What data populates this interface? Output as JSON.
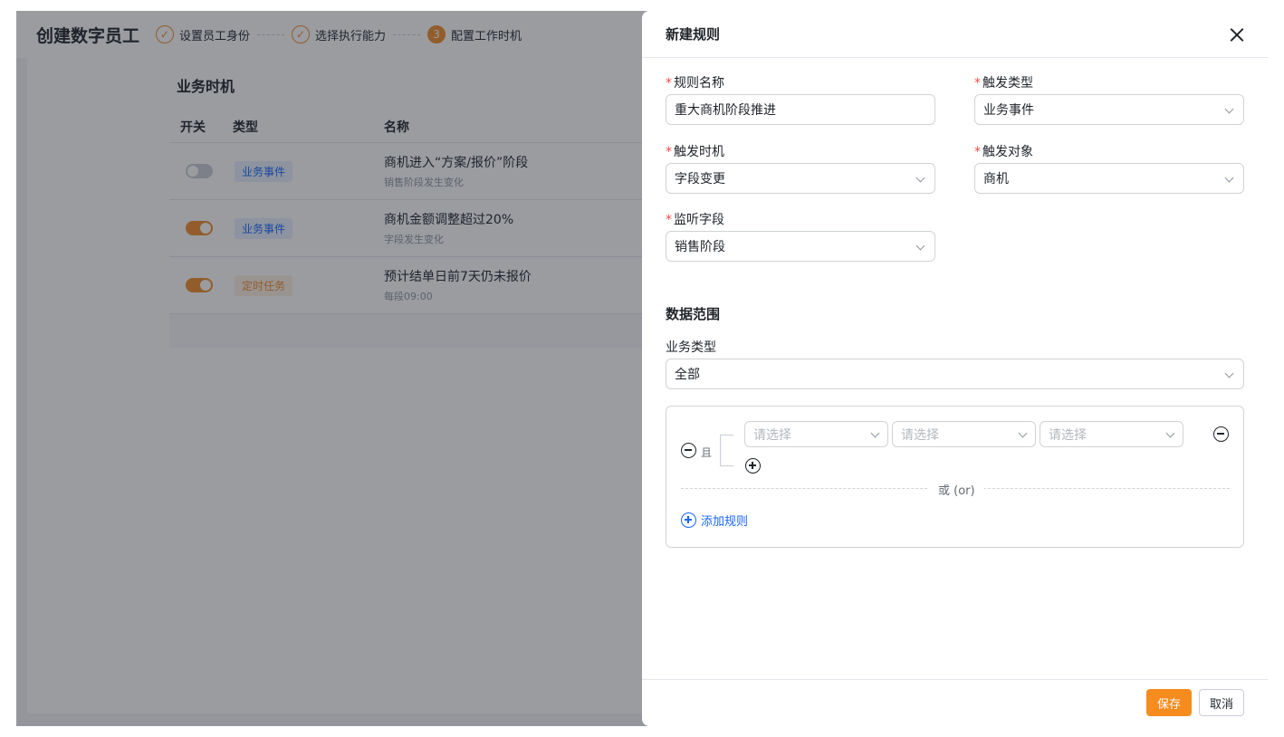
{
  "app": {
    "title": "创建数字员工",
    "steps": [
      {
        "num": "",
        "label": "设置员工身份"
      },
      {
        "num": "",
        "label": "选择执行能力"
      },
      {
        "num": "3",
        "label": "配置工作时机"
      }
    ]
  },
  "page": {
    "section_title": "业务时机",
    "columns": [
      "开关",
      "类型",
      "名称"
    ],
    "rows": [
      {
        "enabled": false,
        "type": "业务事件",
        "name": "商机进入“方案/报价”阶段",
        "desc": "销售阶段发生变化"
      },
      {
        "enabled": true,
        "type": "业务事件",
        "name": "商机金额调整超过20%",
        "desc": "字段发生变化"
      },
      {
        "enabled": true,
        "type": "定时任务",
        "name": "预计结单日前7天仍未报价",
        "desc": "每段09:00"
      }
    ]
  },
  "drawer": {
    "title": "新建规则",
    "required_mark": "*",
    "fields": {
      "rule_name": {
        "label": "规则名称",
        "value": "重大商机阶段推进"
      },
      "trigger_type": {
        "label": "触发类型",
        "value": "业务事件"
      },
      "trigger_timing": {
        "label": "触发时机",
        "value": "字段变更"
      },
      "trigger_object": {
        "label": "触发对象",
        "value": "商机"
      },
      "listen_field": {
        "label": "监听字段",
        "value": "销售阶段"
      }
    },
    "data_scope": {
      "title": "数据范围",
      "business_type_label": "业务类型",
      "business_type_value": "全部",
      "and_label": "且",
      "placeholder": "请选择",
      "or_label": "或 (or)",
      "add_rule_label": "添加规则"
    },
    "footer": {
      "save_label": "保存",
      "cancel_label": "取消"
    }
  },
  "colors": {
    "accent": "#f68b1e",
    "link": "#1664ff",
    "required": "#f54a45"
  }
}
